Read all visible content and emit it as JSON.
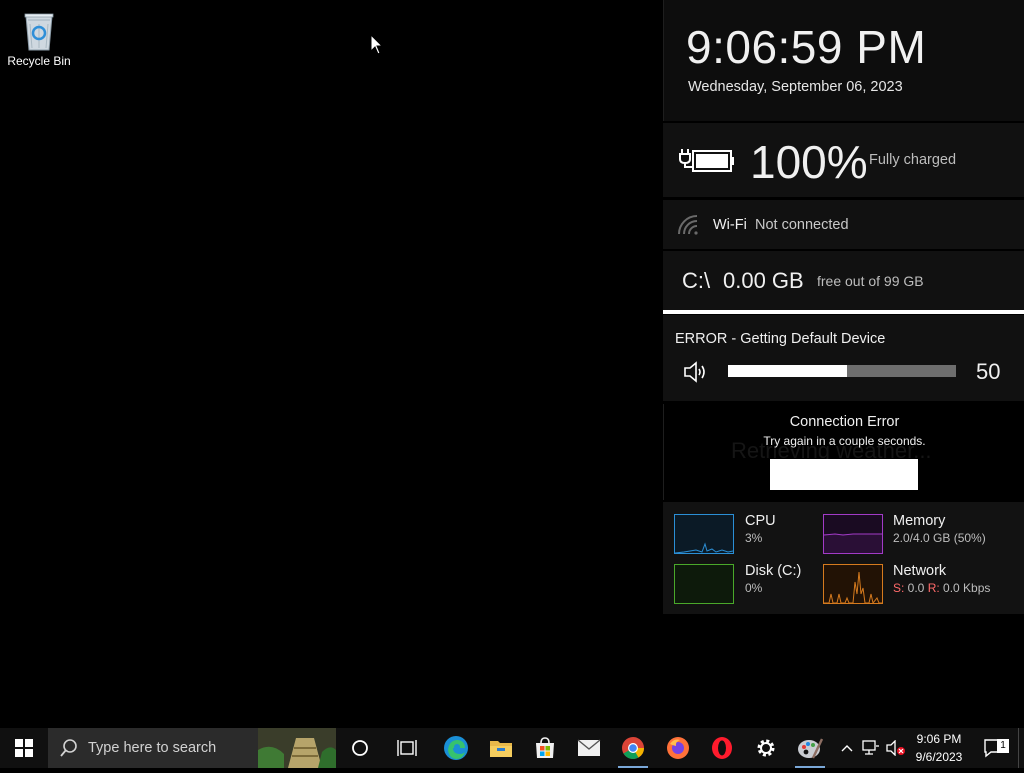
{
  "desktop": {
    "recycle_bin_label": "Recycle Bin"
  },
  "clock": {
    "time": "9:06:59 PM",
    "date": "Wednesday, September 06, 2023"
  },
  "battery": {
    "percent_label": "100%",
    "status": "Fully charged",
    "level": 1.0
  },
  "wifi": {
    "name": "Wi-Fi",
    "status": "Not connected"
  },
  "disk": {
    "drive": "C:\\",
    "free": "0.00 GB",
    "total": "free out of 99 GB"
  },
  "volume": {
    "error": "ERROR - Getting Default Device",
    "value": "50",
    "level": 0.52
  },
  "weather": {
    "ghost_text": "Retrieving weather...",
    "title": "Connection Error",
    "subtitle": "Try again in a couple seconds."
  },
  "performance": {
    "cpu": {
      "name": "CPU",
      "value": "3%",
      "color": "#2b8fd6"
    },
    "memory": {
      "name": "Memory",
      "value": "2.0/4.0 GB (50%)",
      "color": "#a23bc7"
    },
    "disk": {
      "name": "Disk (C:)",
      "value": "0%",
      "color": "#4aa82a"
    },
    "network": {
      "name": "Network",
      "s_label": "S:",
      "s_value": " 0.0 ",
      "r_label": "R:",
      "r_value": " 0.0 Kbps",
      "color": "#d57a1e"
    }
  },
  "taskbar": {
    "search_placeholder": "Type here to search",
    "apps": [
      "start-icon",
      "cortana-icon",
      "task-view-icon",
      "edge-icon",
      "file-explorer-icon",
      "store-icon",
      "mail-icon",
      "chrome-icon",
      "firefox-icon",
      "opera-icon",
      "settings-icon",
      "paint-icon"
    ],
    "tray_time": "9:06 PM",
    "tray_date": "9/6/2023",
    "notifications_count": "1"
  }
}
